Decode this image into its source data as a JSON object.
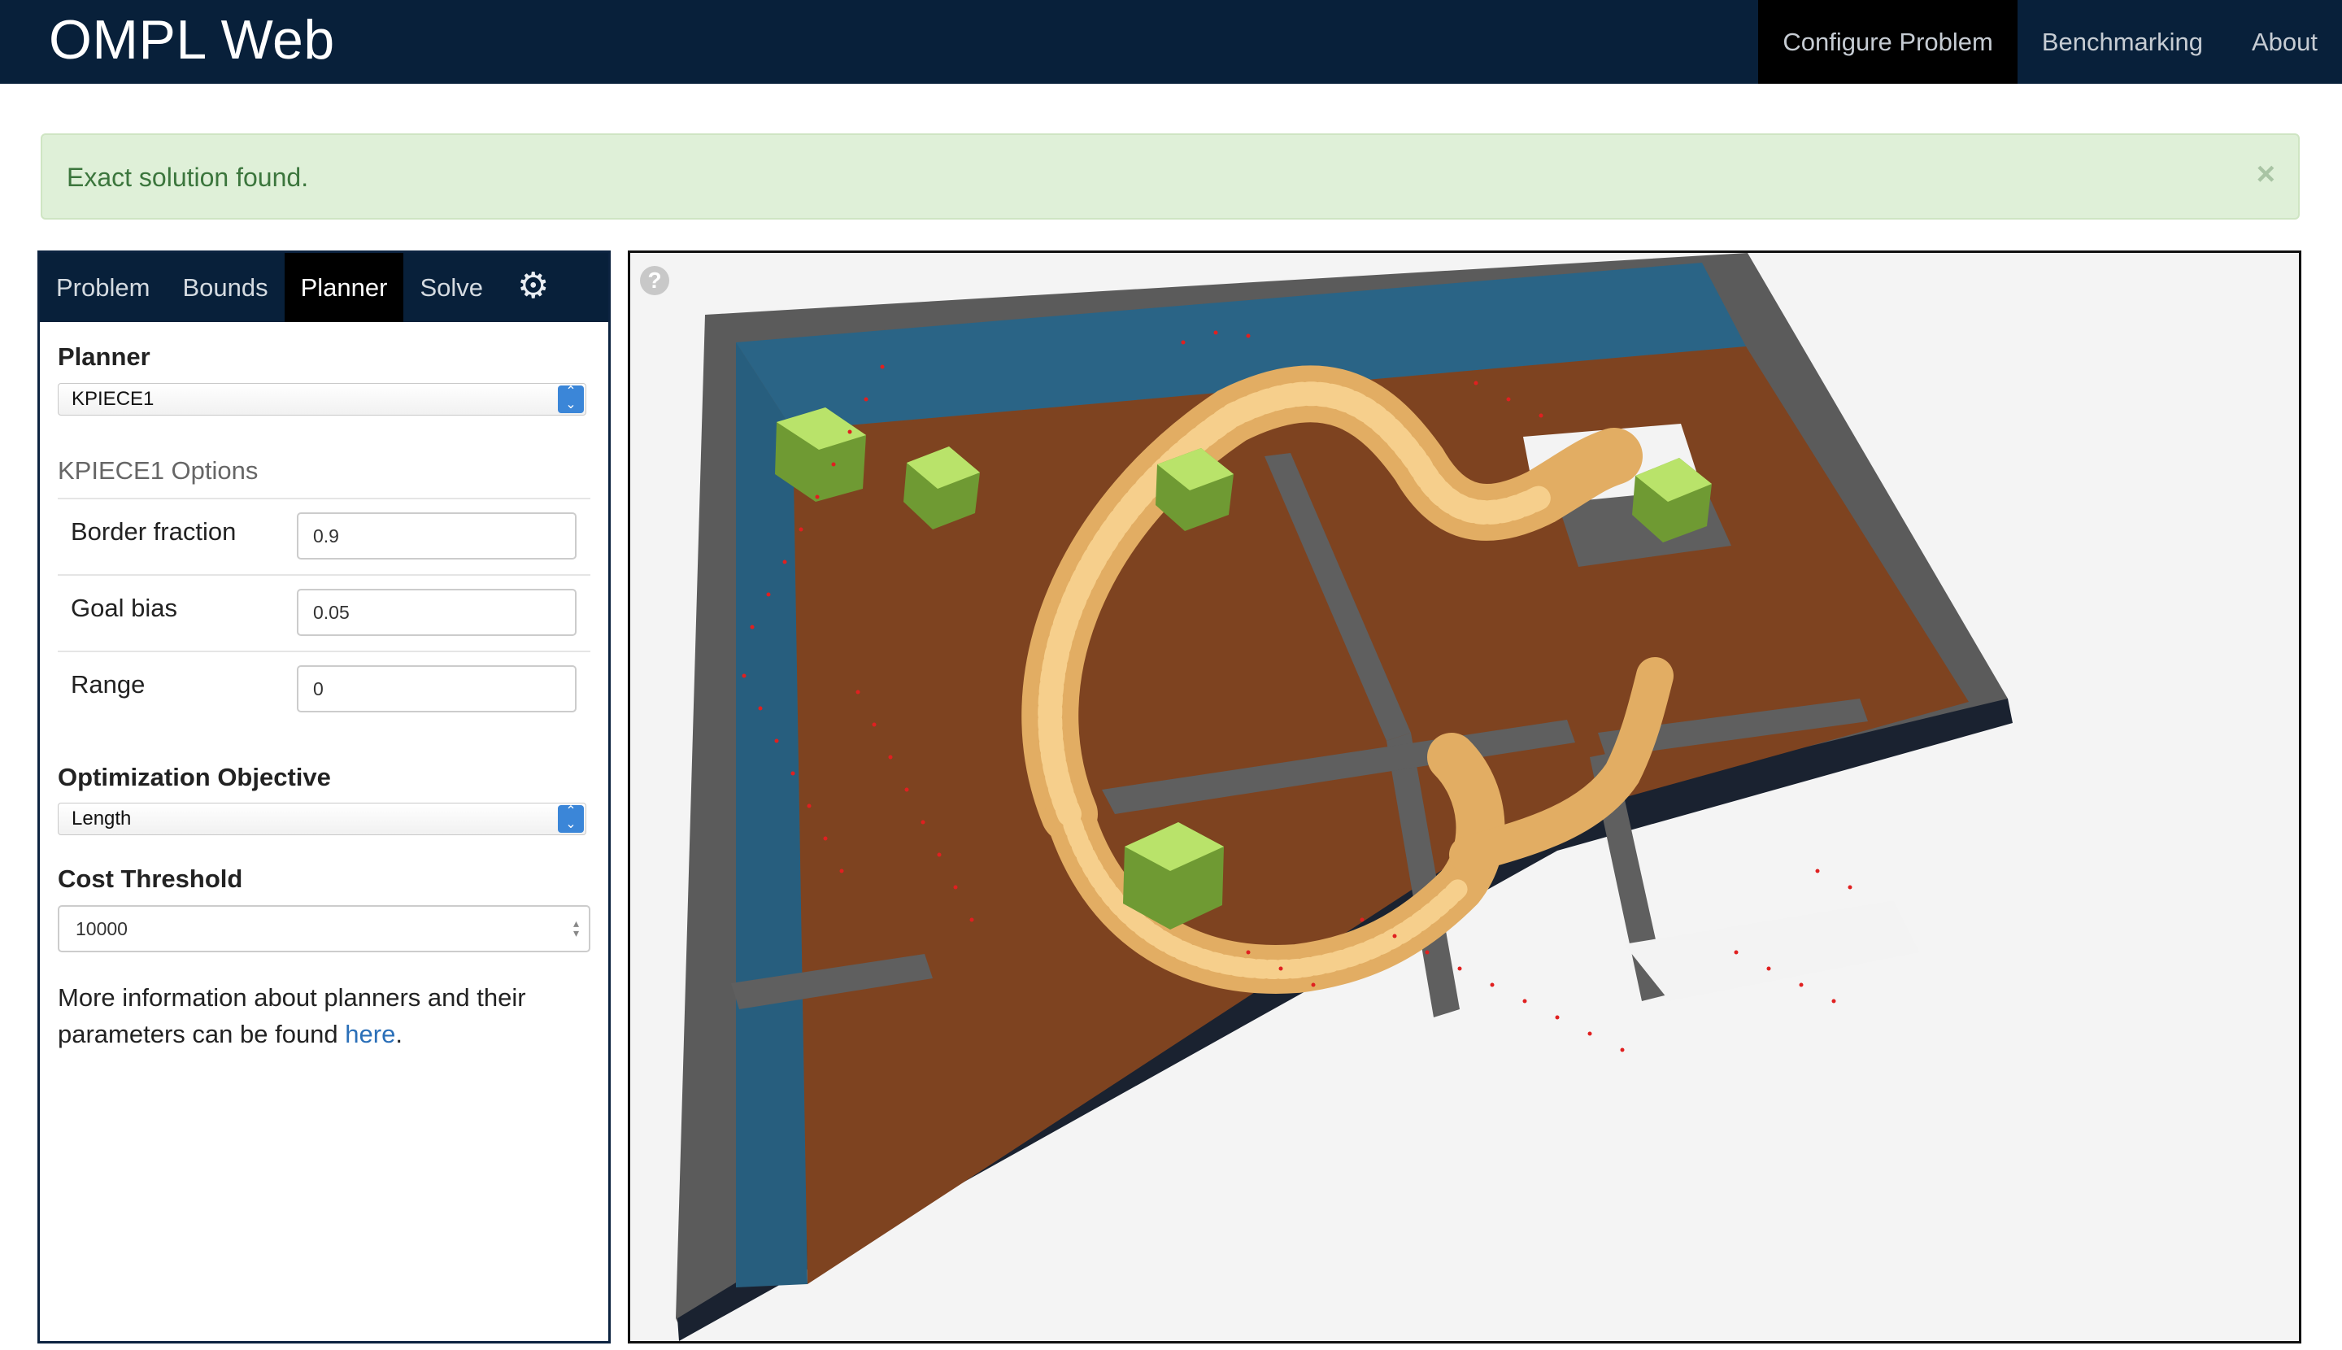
{
  "navbar": {
    "brand": "OMPL Web",
    "items": [
      {
        "label": "Configure Problem",
        "active": true
      },
      {
        "label": "Benchmarking",
        "active": false
      },
      {
        "label": "About",
        "active": false
      }
    ]
  },
  "alert": {
    "message": "Exact solution found.",
    "close": "×"
  },
  "panel": {
    "tabs": [
      "Problem",
      "Bounds",
      "Planner",
      "Solve"
    ],
    "active_tab": "Planner",
    "planner_label": "Planner",
    "planner_value": "KPIECE1",
    "options_title": "KPIECE1 Options",
    "options": [
      {
        "label": "Border fraction",
        "value": "0.9"
      },
      {
        "label": "Goal bias",
        "value": "0.05"
      },
      {
        "label": "Range",
        "value": "0"
      }
    ],
    "objective_label": "Optimization Objective",
    "objective_value": "Length",
    "cost_label": "Cost Threshold",
    "cost_value": "10000",
    "info_text": "More information about planners and their parameters can be found ",
    "info_link": "here",
    "info_end": "."
  },
  "viewport": {
    "help": "?"
  },
  "colors": {
    "navbar": "#08203a",
    "alert_bg": "#dff0d8",
    "alert_text": "#3c763d",
    "floor": "#7e4320",
    "wall_top": "#6e6e6e",
    "wall_inner": "#2a6486",
    "robot": "#f1c47a",
    "obstacle": "#9acd4e",
    "samples": "#e02020"
  },
  "icons": [
    "gear-icon",
    "help-icon",
    "close-icon",
    "select-arrow-icon"
  ]
}
